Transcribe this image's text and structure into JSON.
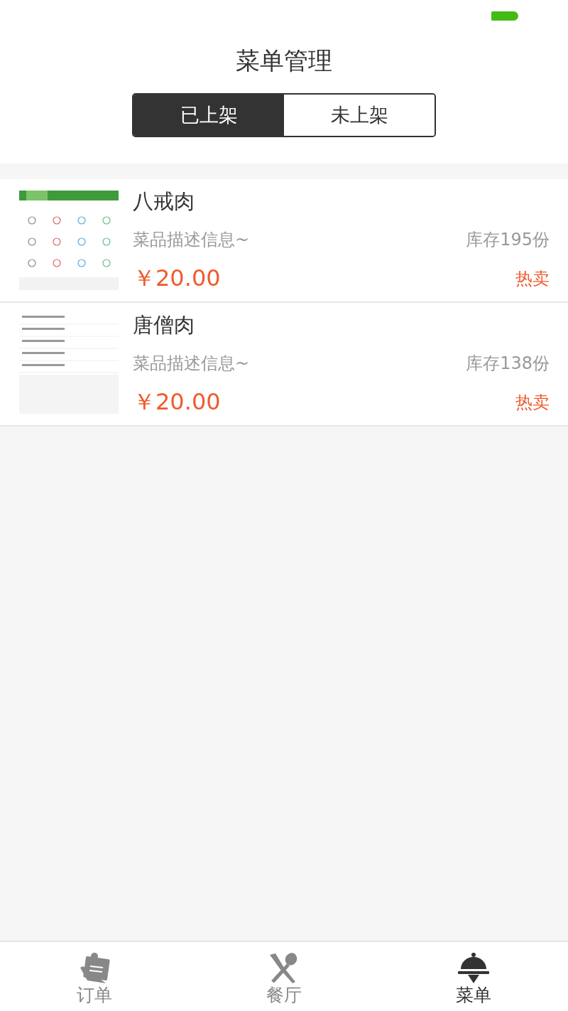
{
  "title": "菜单管理",
  "tabs": [
    {
      "label": "已上架",
      "selected": true
    },
    {
      "label": "未上架",
      "selected": false
    }
  ],
  "dishes": [
    {
      "name": "八戒肉",
      "description": "菜品描述信息~",
      "stock": "库存195份",
      "price": "￥20.00",
      "tag": "热卖"
    },
    {
      "name": "唐僧肉",
      "description": "菜品描述信息~",
      "stock": "库存138份",
      "price": "￥20.00",
      "tag": "热卖"
    }
  ],
  "nav": [
    {
      "label": "订单",
      "kind": "orders",
      "selected": false
    },
    {
      "label": "餐厅",
      "kind": "restaurant",
      "selected": false
    },
    {
      "label": "菜单",
      "kind": "menu",
      "selected": true
    }
  ]
}
